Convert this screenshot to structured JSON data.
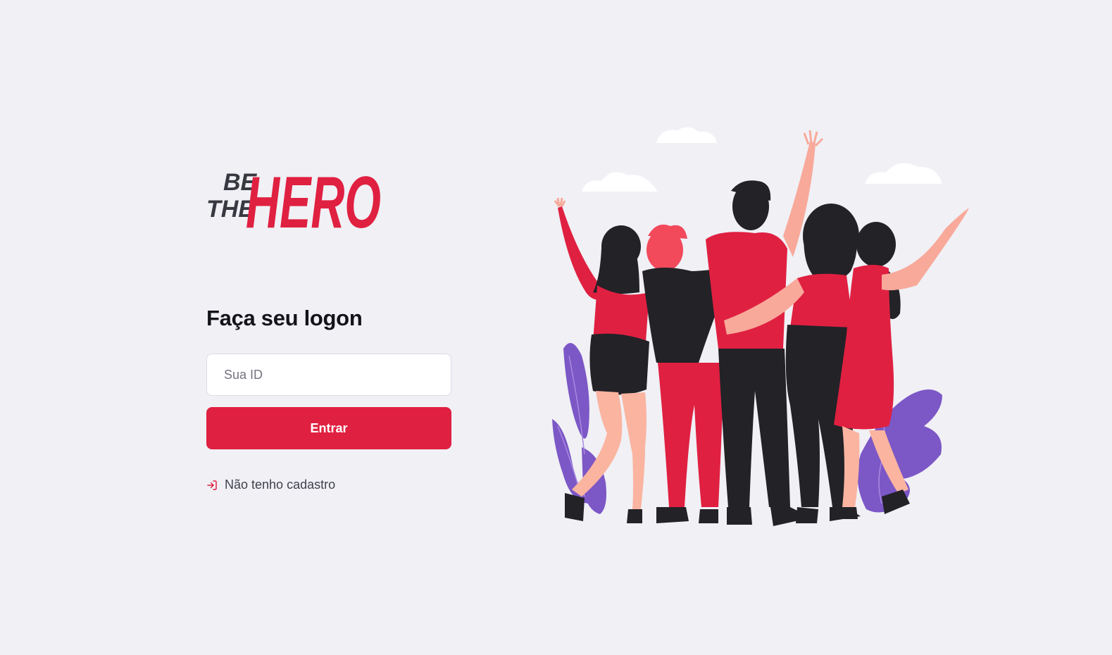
{
  "logo": {
    "line1": "BE",
    "line2": "THE",
    "brand": "HERO",
    "color_dark": "#383840",
    "color_accent": "#e02041"
  },
  "form": {
    "title": "Faça seu logon",
    "id_input": {
      "placeholder": "Sua ID",
      "value": ""
    },
    "submit_label": "Entrar"
  },
  "register_link": {
    "label": "Não tenho cadastro",
    "icon": "log-in-icon"
  },
  "illustration": {
    "icon": "heroes-group-illustration"
  },
  "colors": {
    "background": "#f0f0f5",
    "accent": "#e02041",
    "text": "#13131a",
    "muted": "#41414d"
  }
}
